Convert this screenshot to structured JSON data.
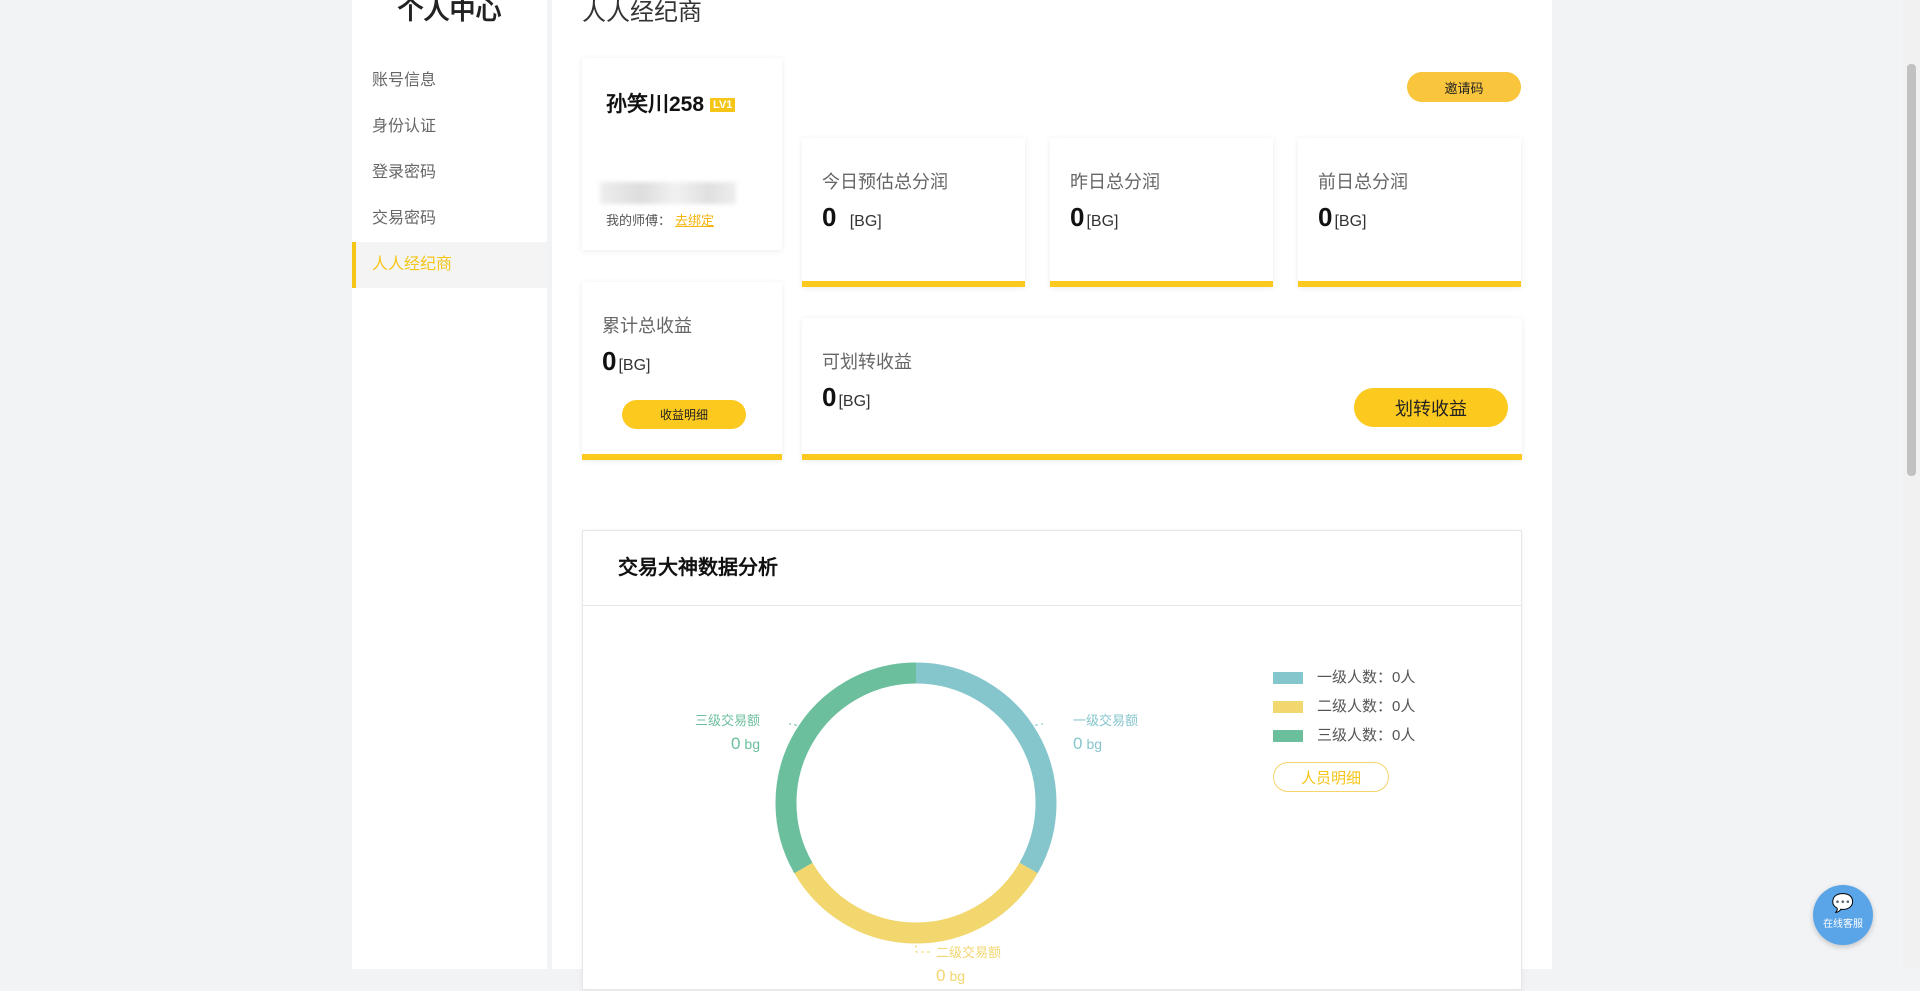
{
  "sidebar": {
    "title": "个人中心",
    "items": [
      {
        "label": "账号信息"
      },
      {
        "label": "身份认证"
      },
      {
        "label": "登录密码"
      },
      {
        "label": "交易密码"
      },
      {
        "label": "人人经纪商"
      }
    ],
    "active_index": 4,
    "accent_color": "#f5c518"
  },
  "main": {
    "title": "人人经纪商",
    "profile": {
      "username": "孙笑川258",
      "level": "LV1",
      "master_label": "我的师傅：",
      "master_link": "去绑定"
    },
    "invite_label": "邀请码",
    "stats": [
      {
        "label": "今日预估总分润",
        "value": "0",
        "unit": "[BG]"
      },
      {
        "label": "昨日总分润",
        "value": "0",
        "unit": "[BG]"
      },
      {
        "label": "前日总分润",
        "value": "0",
        "unit": "[BG]"
      }
    ],
    "total": {
      "label": "累计总收益",
      "value": "0",
      "unit": "[BG]",
      "button": "收益明细"
    },
    "transfer": {
      "label": "可划转收益",
      "value": "0",
      "unit": "[BG]",
      "button": "划转收益"
    },
    "analysis": {
      "title": "交易大神数据分析",
      "chart_labels": [
        {
          "name": "一级交易额",
          "value": "0",
          "unit": "bg",
          "color": "#85c6cd"
        },
        {
          "name": "二级交易额",
          "value": "0",
          "unit": "bg",
          "color": "#f2d66e"
        },
        {
          "name": "三级交易额",
          "value": "0",
          "unit": "bg",
          "color": "#6bbf9c"
        }
      ],
      "legend": [
        {
          "label": "一级人数：0人",
          "color": "#85c6cd"
        },
        {
          "label": "二级人数：0人",
          "color": "#f2d66e"
        },
        {
          "label": "三级人数：0人",
          "color": "#6bbf9c"
        }
      ],
      "people_button": "人员明细"
    }
  },
  "service": {
    "label": "在线客服",
    "icon": "chat-icon"
  }
}
